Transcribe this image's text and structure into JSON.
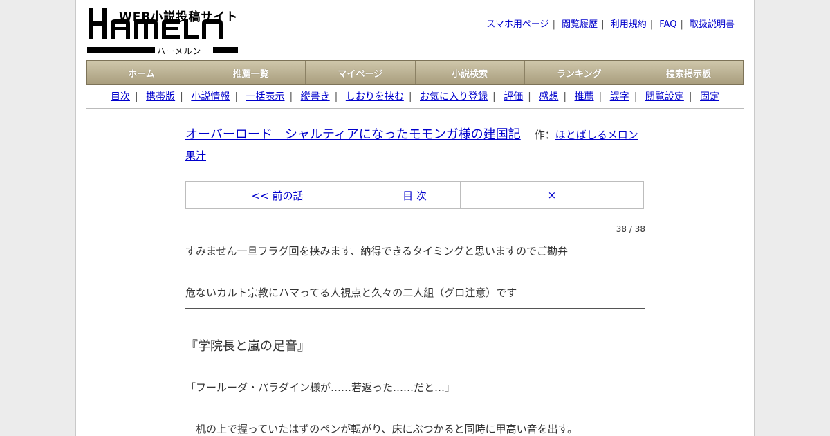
{
  "logo": {
    "tagline": "WEB小説投稿サイト",
    "name": "HAMELN",
    "reading": "ハーメルン"
  },
  "top_links": [
    "スマホ用ページ",
    "閲覧履歴",
    "利用規約",
    "FAQ",
    "取扱説明書"
  ],
  "main_nav": [
    "ホーム",
    "推薦一覧",
    "マイページ",
    "小説検索",
    "ランキング",
    "捜索掲示板"
  ],
  "sub_nav": [
    "目次",
    "携帯版",
    "小説情報",
    "一括表示",
    "縦書き",
    "しおりを挟む",
    "お気に入り登録",
    "評価",
    "感想",
    "推薦",
    "誤字",
    "閲覧設定",
    "固定"
  ],
  "novel": {
    "title": "オーバーロード　シャルティアになったモモンガ様の建国記",
    "author_label": "作：",
    "author": "ほとばしるメロン果汁"
  },
  "chapter_nav": {
    "prev": "<< 前の話",
    "toc": "目 次",
    "next": "×"
  },
  "page_count": "38 / 38",
  "preface": [
    "すみません一旦フラグ回を挟みます、納得できるタイミングと思いますのでご勘弁",
    "危ないカルト宗教にハマってる人視点と久々の二人組（グロ注意）です"
  ],
  "chapter_title": "『学院長と嵐の足音』",
  "paragraphs": [
    "「フールーダ・パラダイン様が……若返った……だと…」",
    "　机の上で握っていたはずのペンが転がり、床にぶつかると同時に甲高い音を出す。"
  ],
  "colors": {
    "link": "#0000cc",
    "nav_gradient_top": "#cfc7ab",
    "nav_gradient_bottom": "#a89d7d"
  }
}
